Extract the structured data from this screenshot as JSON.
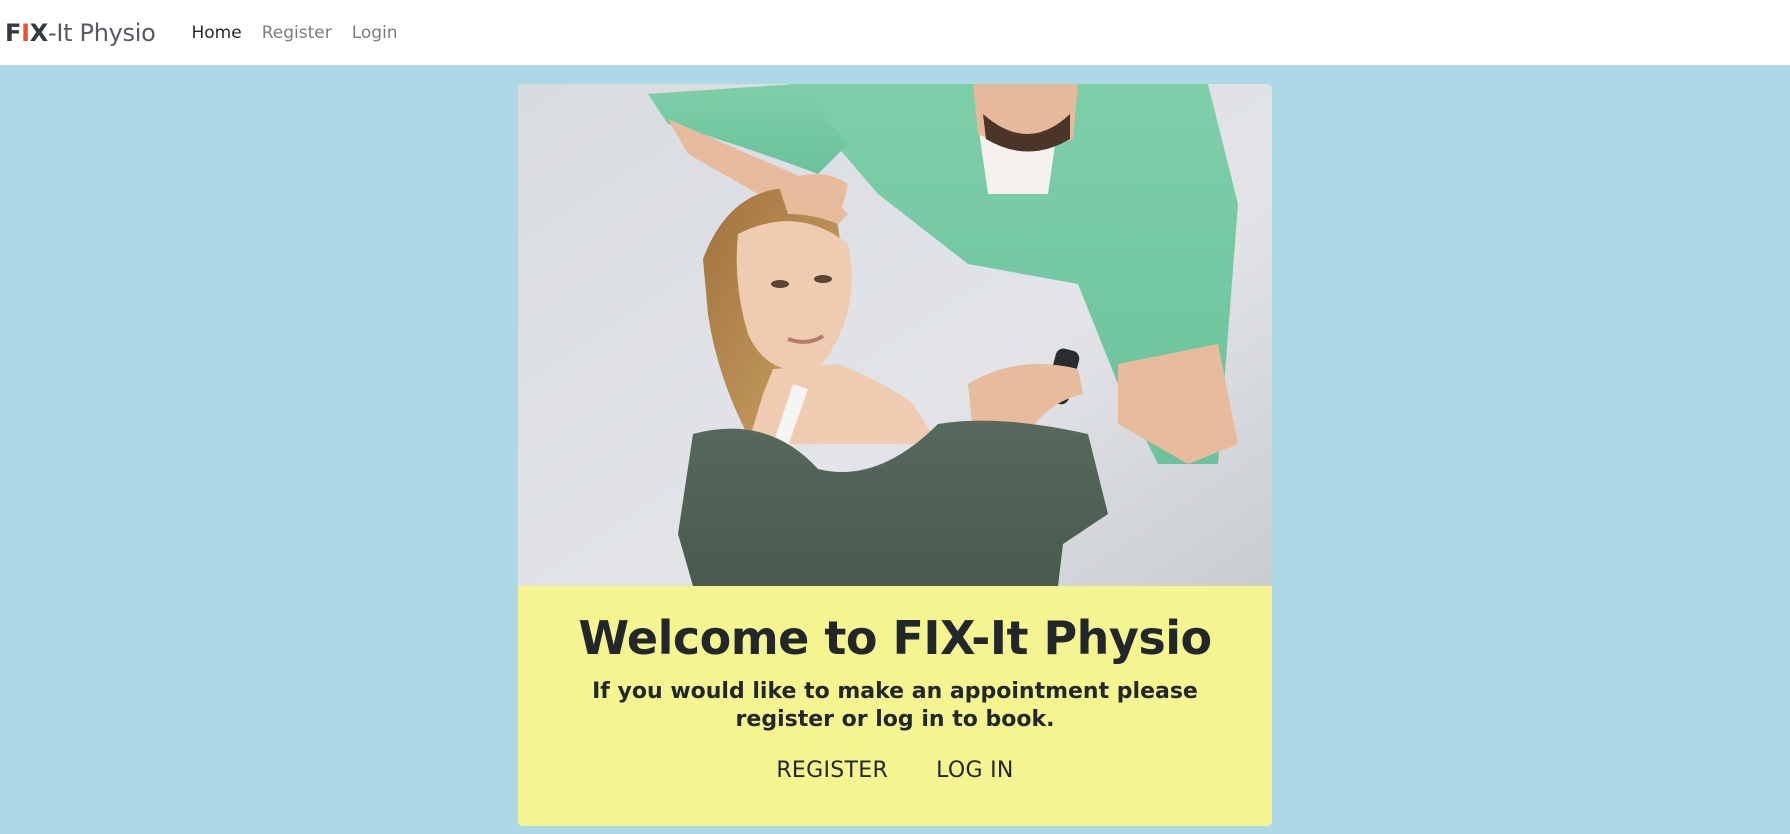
{
  "navbar": {
    "brand": {
      "f": "F",
      "i": "I",
      "x": "X",
      "rest": "-It Physio"
    },
    "links": [
      {
        "label": "Home",
        "active": true
      },
      {
        "label": "Register",
        "active": false
      },
      {
        "label": "Login",
        "active": false
      }
    ]
  },
  "hero": {
    "icon": "photo-physiotherapist-neck-treatment"
  },
  "card": {
    "title": "Welcome to FIX-It Physio",
    "subtitle": "If you would like to make an appointment please register or log in to book.",
    "actions": [
      {
        "label": "REGISTER"
      },
      {
        "label": "LOG IN"
      }
    ]
  },
  "colors": {
    "page_background": "#add8e6",
    "card_background": "#f4f491",
    "brand_accent": "#e4572e",
    "text_dark": "#22272b",
    "nav_muted": "#7a7d80"
  }
}
